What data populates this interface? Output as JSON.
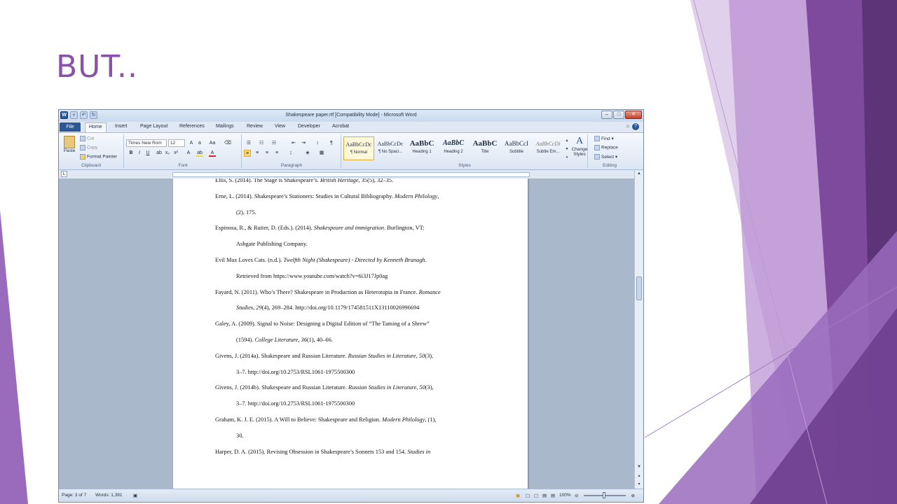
{
  "slide": {
    "title": "BUT.."
  },
  "window": {
    "title": "Shakespeare paper.rtf [Compatibility Mode] - Microsoft Word",
    "tabs": [
      "File",
      "Home",
      "Insert",
      "Page Layout",
      "References",
      "Mailings",
      "Review",
      "View",
      "Developer",
      "Acrobat"
    ],
    "active_tab": "Home"
  },
  "ribbon": {
    "clipboard": {
      "paste": "Paste",
      "cut": "Cut",
      "copy": "Copy",
      "format_painter": "Format Painter",
      "label": "Clipboard"
    },
    "font": {
      "name": "Times New Rom",
      "size": "12",
      "label": "Font"
    },
    "paragraph": {
      "label": "Paragraph"
    },
    "styles": {
      "label": "Styles",
      "items": [
        {
          "sample": "AaBbCcDc",
          "name": "¶ Normal"
        },
        {
          "sample": "AaBbCcDc",
          "name": "¶ No Spaci..."
        },
        {
          "sample": "AaBbC",
          "name": "Heading 1"
        },
        {
          "sample": "AaBbC",
          "name": "Heading 2"
        },
        {
          "sample": "AaBbC",
          "name": "Title"
        },
        {
          "sample": "AaBbCcI",
          "name": "Subtitle"
        },
        {
          "sample": "AaBbCcDi",
          "name": "Subtle Em..."
        }
      ],
      "change_styles": "Change Styles"
    },
    "editing": {
      "find": "Find",
      "replace": "Replace",
      "select": "Select",
      "label": "Editing"
    }
  },
  "document": {
    "lines": [
      {
        "parts": [
          [
            "Ellis, S. (2014). The Stage is Shakespeare’s. ",
            false
          ],
          [
            "British Heritage",
            true
          ],
          [
            ", 35(5), 32–35.",
            false
          ]
        ]
      },
      {
        "parts": [
          [
            "Erne, L. (2014). Shakespeare’s Stationers: Studies in Cultural Bibliography. ",
            false
          ],
          [
            "Modern Philology",
            true
          ],
          [
            ",",
            false
          ]
        ]
      },
      {
        "parts": [
          [
            "(2), 175.",
            false
          ]
        ],
        "indent": true
      },
      {
        "parts": [
          [
            "Espinosa, R., & Ruiter, D. (Eds.). (2014). ",
            false
          ],
          [
            "Shakespeare and immigration",
            true
          ],
          [
            ". Burlington, VT:",
            false
          ]
        ]
      },
      {
        "parts": [
          [
            "Ashgate Publishing Company.",
            false
          ]
        ],
        "indent": true
      },
      {
        "parts": [
          [
            "Evil Max Loves Cats. (n.d.). ",
            false
          ],
          [
            "Twelfth Night (Shakespeare) - Directed by Kenneth Branagh",
            true
          ],
          [
            ".",
            false
          ]
        ]
      },
      {
        "parts": [
          [
            "Retrieved from https://www.youtube.com/watch?v=6i3J17Jp0ag",
            false
          ]
        ],
        "indent": true
      },
      {
        "parts": [
          [
            "Fayard, N. (2011). Who’s There? Shakespeare in Production as Heterotopia in France. ",
            false
          ],
          [
            "Romance",
            true
          ]
        ]
      },
      {
        "parts": [
          [
            "Studies",
            true
          ],
          [
            ", ",
            false
          ],
          [
            "29",
            true
          ],
          [
            "(4), 269–284. http://doi.org/10.1179/174581511X13110026996694",
            false
          ]
        ],
        "indent": true
      },
      {
        "parts": [
          [
            "Galey, A. (2009). Signal to Noise: Designing a Digital Edition of “The Taming of a Shrew”",
            false
          ]
        ]
      },
      {
        "parts": [
          [
            "(1594). ",
            false
          ],
          [
            "College Literature",
            true
          ],
          [
            ", ",
            false
          ],
          [
            "36",
            true
          ],
          [
            "(1), 40–66.",
            false
          ]
        ],
        "indent": true
      },
      {
        "parts": [
          [
            "Givens, J. (2014a). Shakespeare and Russian Literature. ",
            false
          ],
          [
            "Russian Studies in Literature",
            true
          ],
          [
            ", ",
            false
          ],
          [
            "50",
            true
          ],
          [
            "(3),",
            false
          ]
        ]
      },
      {
        "parts": [
          [
            "3–7. http://doi.org/10.2753/RSL1061-1975500300",
            false
          ]
        ],
        "indent": true
      },
      {
        "parts": [
          [
            "Givens, J. (2014b). Shakespeare and Russian Literature. ",
            false
          ],
          [
            "Russian Studies in Literature",
            true
          ],
          [
            ", ",
            false
          ],
          [
            "50",
            true
          ],
          [
            "(3),",
            false
          ]
        ]
      },
      {
        "parts": [
          [
            "3–7. http://doi.org/10.2753/RSL1061-1975500300",
            false
          ]
        ],
        "indent": true
      },
      {
        "parts": [
          [
            "Graham, K. J. E. (2015). A Will to Believe: Shakespeare and Religion. ",
            false
          ],
          [
            "Modern Philology",
            true
          ],
          [
            ", (1),",
            false
          ]
        ]
      },
      {
        "parts": [
          [
            "30.",
            false
          ]
        ],
        "indent": true
      },
      {
        "parts": [
          [
            "Harper, D. A. (2015). Revising Obsession in Shakespeare’s Sonnets 153 and 154. ",
            false
          ],
          [
            "Studies in",
            true
          ]
        ]
      }
    ]
  },
  "status": {
    "page": "Page: 3 of 7",
    "words": "Words: 1,391",
    "zoom": "100%"
  }
}
